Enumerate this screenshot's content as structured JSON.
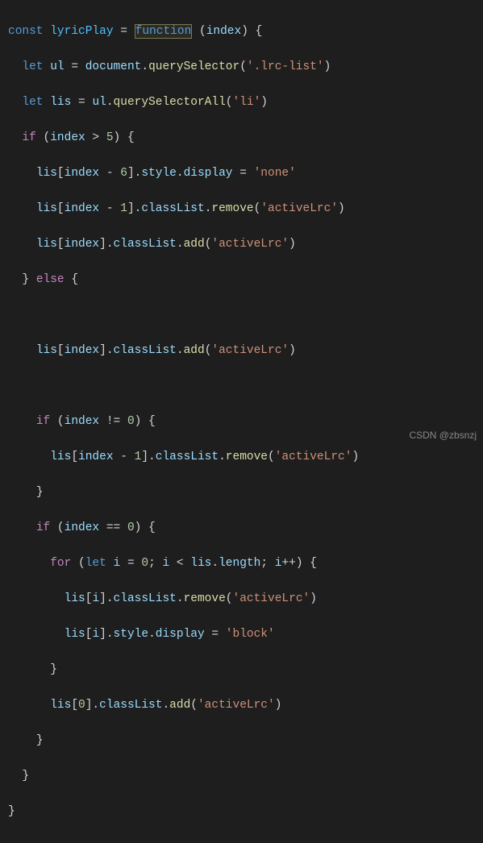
{
  "watermark": "CSDN @zbsnzj",
  "code": {
    "l1": {
      "kw1": "const",
      "name": "lyricPlay",
      "eq": " = ",
      "kw2": "function",
      "sp": " ",
      "po": "(",
      "param": "index",
      "pc": ") {"
    },
    "l2": {
      "kw": "let",
      "sp": " ",
      "v": "ul",
      "eq": " = ",
      "obj": "document",
      "dot": ".",
      "fn": "querySelector",
      "po": "(",
      "str": "'.lrc-list'",
      "pc": ")"
    },
    "l3": {
      "kw": "let",
      "sp": " ",
      "v": "lis",
      "eq": " = ",
      "obj": "ul",
      "dot": ".",
      "fn": "querySelectorAll",
      "po": "(",
      "str": "'li'",
      "pc": ")"
    },
    "l4": {
      "kw": "if",
      "sp": " (",
      "v": "index",
      "op": " > ",
      "num": "5",
      "pc": ") {"
    },
    "l5": {
      "arr": "lis",
      "bo": "[",
      "v": "index",
      "op": " - ",
      "num": "6",
      "bc": "].",
      "p1": "style",
      "dot": ".",
      "p2": "display",
      "eq": " = ",
      "str": "'none'"
    },
    "l6": {
      "arr": "lis",
      "bo": "[",
      "v": "index",
      "op": " - ",
      "num": "1",
      "bc": "].",
      "p1": "classList",
      "dot": ".",
      "fn": "remove",
      "po": "(",
      "str": "'activeLrc'",
      "pc": ")"
    },
    "l7": {
      "arr": "lis",
      "bo": "[",
      "v": "index",
      "bc": "].",
      "p1": "classList",
      "dot": ".",
      "fn": "add",
      "po": "(",
      "str": "'activeLrc'",
      "pc": ")"
    },
    "l8": {
      "cb": "} ",
      "kw": "else",
      "ob": " {"
    },
    "l9": {
      "arr": "lis",
      "bo": "[",
      "v": "index",
      "bc": "].",
      "p1": "classList",
      "dot": ".",
      "fn": "add",
      "po": "(",
      "str": "'activeLrc'",
      "pc": ")"
    },
    "l10": {
      "kw": "if",
      "sp": " (",
      "v": "index",
      "op": " != ",
      "num": "0",
      "pc": ") {"
    },
    "l11": {
      "arr": "lis",
      "bo": "[",
      "v": "index",
      "op": " - ",
      "num": "1",
      "bc": "].",
      "p1": "classList",
      "dot": ".",
      "fn": "remove",
      "po": "(",
      "str": "'activeLrc'",
      "pc": ")"
    },
    "l12": {
      "cb": "}"
    },
    "l13": {
      "kw": "if",
      "sp": " (",
      "v": "index",
      "op": " == ",
      "num": "0",
      "pc": ") {"
    },
    "l14": {
      "kw": "for",
      "sp": " (",
      "let": "let",
      "sp2": " ",
      "v": "i",
      "eq": " = ",
      "num0": "0",
      "sc": "; ",
      "v2": "i",
      "lt": " < ",
      "arr": "lis",
      "dot": ".",
      "prop": "length",
      "sc2": "; ",
      "v3": "i",
      "inc": "++",
      "pc": ") {"
    },
    "l15": {
      "arr": "lis",
      "bo": "[",
      "v": "i",
      "bc": "].",
      "p1": "classList",
      "dot": ".",
      "fn": "remove",
      "po": "(",
      "str": "'activeLrc'",
      "pc": ")"
    },
    "l16": {
      "arr": "lis",
      "bo": "[",
      "v": "i",
      "bc": "].",
      "p1": "style",
      "dot": ".",
      "p2": "display",
      "eq": " = ",
      "str": "'block'"
    },
    "l17": {
      "cb": "}"
    },
    "l18": {
      "arr": "lis",
      "bo": "[",
      "num": "0",
      "bc": "].",
      "p1": "classList",
      "dot": ".",
      "fn": "add",
      "po": "(",
      "str": "'activeLrc'",
      "pc": ")"
    },
    "l19": {
      "cb": "}"
    },
    "l20": {
      "cb": "}"
    },
    "l21": {
      "cb": "}"
    }
  }
}
